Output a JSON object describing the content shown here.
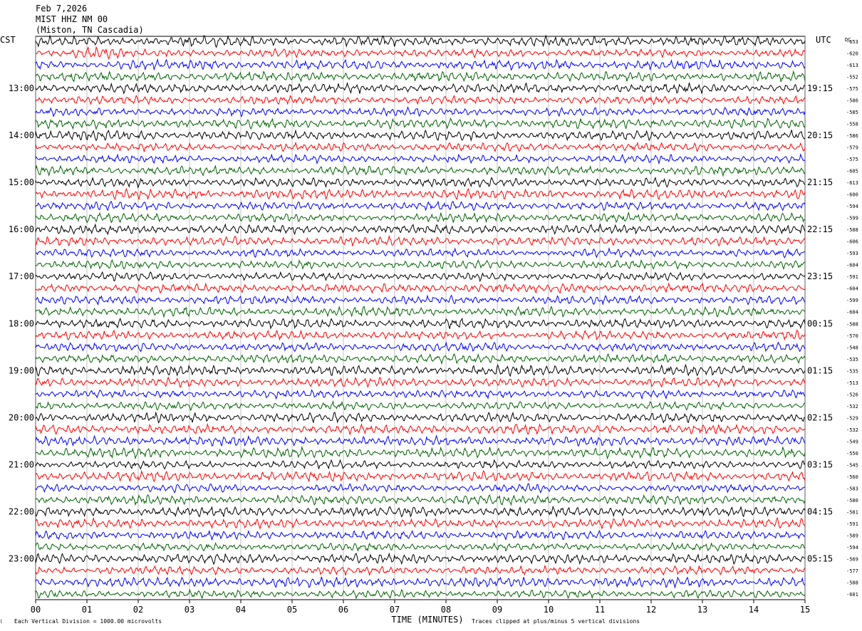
{
  "header": {
    "date": "Feb 7,2026",
    "station": "MIST HHZ NM 00",
    "location": "(Miston, TN Cascadia)"
  },
  "chart_data": {
    "type": "line",
    "title": "",
    "xlabel": "TIME (MINUTES)",
    "left_axis_label": "CST",
    "right_axis_label": "UTC",
    "dc_label": "DC",
    "xlim": [
      0,
      15
    ],
    "x_ticks": [
      "00",
      "01",
      "02",
      "03",
      "04",
      "05",
      "06",
      "07",
      "08",
      "09",
      "10",
      "11",
      "12",
      "13",
      "14",
      "15"
    ],
    "left_hour_labels": [
      "13:00",
      "14:00",
      "15:00",
      "16:00",
      "17:00",
      "18:00",
      "19:00",
      "20:00",
      "21:00",
      "22:00",
      "23:00"
    ],
    "right_hour_labels": [
      "19:15",
      "20:15",
      "21:15",
      "22:15",
      "23:15",
      "00:15",
      "01:15",
      "02:15",
      "03:15",
      "04:15",
      "05:15"
    ],
    "trace_colors": [
      "#000000",
      "#ff0000",
      "#0000ff",
      "#006400"
    ],
    "trace_count": 48,
    "dc_offsets": [
      "-653",
      "-620",
      "-613",
      "-552",
      "-575",
      "-586",
      "-585",
      "-558",
      "-586",
      "-579",
      "-575",
      "-605",
      "-613",
      "-600",
      "-594",
      "-599",
      "-588",
      "-606",
      "-593",
      "-604",
      "-591",
      "-604",
      "-599",
      "-604",
      "-588",
      "-570",
      "-548",
      "-535",
      "-535",
      "-513",
      "-526",
      "-532",
      "-529",
      "-532",
      "-549",
      "-550",
      "-545",
      "-560",
      "-583",
      "-580",
      "-581",
      "-591",
      "-589",
      "-594",
      "-569",
      "-577",
      "-588",
      "-601"
    ],
    "footer_scale": "Each Vertical Division = 1000.00 microvolts",
    "footer_clip": "Traces clipped at plus/minus 5 vertical divisions"
  }
}
